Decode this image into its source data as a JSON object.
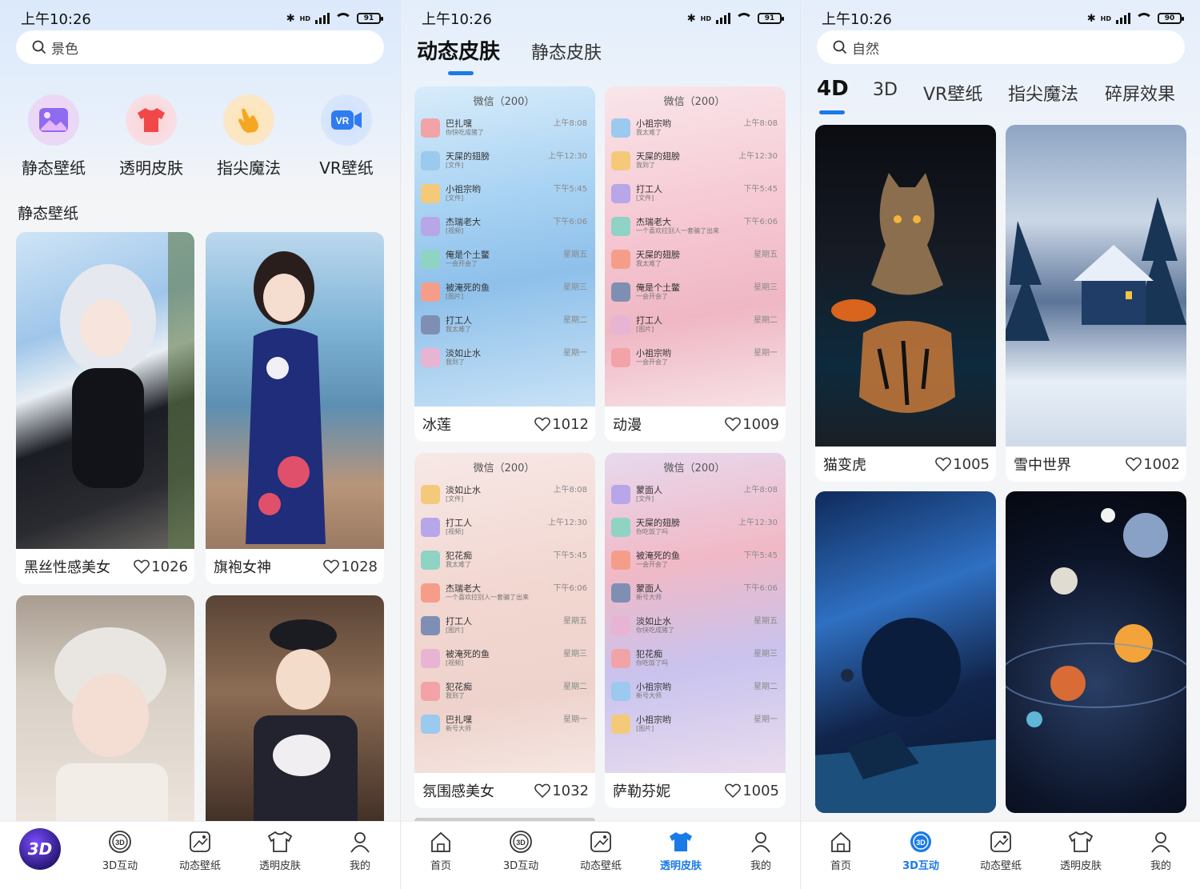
{
  "screen1": {
    "status": {
      "time": "上午10:26",
      "battery": "91",
      "net": "HD"
    },
    "search": {
      "placeholder": "景色"
    },
    "categories": [
      {
        "label": "静态壁纸",
        "icon": "image-icon"
      },
      {
        "label": "透明皮肤",
        "icon": "tshirt-icon"
      },
      {
        "label": "指尖魔法",
        "icon": "pointer-hand-icon"
      },
      {
        "label": "VR壁纸",
        "icon": "vr-camera-icon"
      }
    ],
    "section_title": "静态壁纸",
    "cards": [
      {
        "title": "黑丝性感美女",
        "likes": "1026"
      },
      {
        "title": "旗袍女神",
        "likes": "1028"
      },
      {
        "title": "",
        "likes": ""
      },
      {
        "title": "",
        "likes": ""
      }
    ],
    "tabbar": [
      {
        "label": "",
        "icon": "app-logo-3d"
      },
      {
        "label": "3D互动",
        "icon": "3d-icon"
      },
      {
        "label": "动态壁纸",
        "icon": "dynamic-wallpaper-icon"
      },
      {
        "label": "透明皮肤",
        "icon": "tshirt-icon"
      },
      {
        "label": "我的",
        "icon": "user-icon"
      }
    ],
    "logo_text": "3D"
  },
  "screen2": {
    "status": {
      "time": "上午10:26",
      "battery": "91",
      "net": "HD"
    },
    "tabs": [
      "动态皮肤",
      "静态皮肤"
    ],
    "cards": [
      {
        "title": "冰莲",
        "likes": "1012",
        "chat_title": "微信（200）",
        "rows": [
          {
            "name": "巴扎嘿",
            "msg": "你快吃成猪了",
            "time": "上午8:08"
          },
          {
            "name": "天屎的翅膀",
            "msg": "[文件]",
            "time": "上午12:30"
          },
          {
            "name": "小祖宗哟",
            "msg": "[文件]",
            "time": "下午5:45"
          },
          {
            "name": "杰瑞老大",
            "msg": "[视频]",
            "time": "下午6:06"
          },
          {
            "name": "俺是个土鳖",
            "msg": "一会开会了",
            "time": "星期五"
          },
          {
            "name": "被淹死的鱼",
            "msg": "[图片]",
            "time": "星期三"
          },
          {
            "name": "打工人",
            "msg": "我太难了",
            "time": "星期二"
          },
          {
            "name": "淡如止水",
            "msg": "我到了",
            "time": "星期一"
          }
        ]
      },
      {
        "title": "动漫",
        "likes": "1009",
        "chat_title": "微信（200）",
        "rows": [
          {
            "name": "小祖宗哟",
            "msg": "我太难了",
            "time": "上午8:08"
          },
          {
            "name": "天屎的翅膀",
            "msg": "我到了",
            "time": "上午12:30"
          },
          {
            "name": "打工人",
            "msg": "[文件]",
            "time": "下午5:45"
          },
          {
            "name": "杰瑞老大",
            "msg": "一个喜欢拉别人一套骗了出来",
            "time": "下午6:06"
          },
          {
            "name": "天屎的翅膀",
            "msg": "我太难了",
            "time": "星期五"
          },
          {
            "name": "俺是个土鳖",
            "msg": "一会开会了",
            "time": "星期三"
          },
          {
            "name": "打工人",
            "msg": "[图片]",
            "time": "星期二"
          },
          {
            "name": "小祖宗哟",
            "msg": "一会开会了",
            "time": "星期一"
          }
        ]
      },
      {
        "title": "氛围感美女",
        "likes": "1032",
        "chat_title": "微信（200）",
        "rows": [
          {
            "name": "淡如止水",
            "msg": "[文件]",
            "time": "上午8:08"
          },
          {
            "name": "打工人",
            "msg": "[视频]",
            "time": "上午12:30"
          },
          {
            "name": "犯花痴",
            "msg": "我太难了",
            "time": "下午5:45"
          },
          {
            "name": "杰瑞老大",
            "msg": "一个喜欢拉别人一套骗了出来",
            "time": "下午6:06"
          },
          {
            "name": "打工人",
            "msg": "[图片]",
            "time": "星期五"
          },
          {
            "name": "被淹死的鱼",
            "msg": "[视频]",
            "time": "星期三"
          },
          {
            "name": "犯花痴",
            "msg": "我到了",
            "time": "星期二"
          },
          {
            "name": "巴扎嘿",
            "msg": "新号大师",
            "time": "星期一"
          }
        ]
      },
      {
        "title": "萨勒芬妮",
        "likes": "1005",
        "chat_title": "微信（200）",
        "rows": [
          {
            "name": "蒙面人",
            "msg": "[文件]",
            "time": "上午8:08"
          },
          {
            "name": "天屎的翅膀",
            "msg": "你吃饭了吗",
            "time": "上午12:30"
          },
          {
            "name": "被淹死的鱼",
            "msg": "一会开会了",
            "time": "下午5:45"
          },
          {
            "name": "蒙面人",
            "msg": "新号大师",
            "time": "下午6:06"
          },
          {
            "name": "淡如止水",
            "msg": "你快吃成猪了",
            "time": "星期五"
          },
          {
            "name": "犯花痴",
            "msg": "你吃饭了吗",
            "time": "星期三"
          },
          {
            "name": "小祖宗哟",
            "msg": "新号大师",
            "time": "星期二"
          },
          {
            "name": "小祖宗哟",
            "msg": "[图片]",
            "time": "星期一"
          }
        ]
      }
    ],
    "tabbar": [
      {
        "label": "首页",
        "icon": "home-icon"
      },
      {
        "label": "3D互动",
        "icon": "3d-icon"
      },
      {
        "label": "动态壁纸",
        "icon": "dynamic-wallpaper-icon"
      },
      {
        "label": "透明皮肤",
        "icon": "tshirt-icon"
      },
      {
        "label": "我的",
        "icon": "user-icon"
      }
    ]
  },
  "screen3": {
    "status": {
      "time": "上午10:26",
      "battery": "90",
      "net": "HD"
    },
    "search": {
      "placeholder": "自然"
    },
    "tabs": [
      "4D",
      "3D",
      "VR壁纸",
      "指尖魔法",
      "碎屏效果"
    ],
    "cards": [
      {
        "title": "猫变虎",
        "likes": "1005"
      },
      {
        "title": "雪中世界",
        "likes": "1002"
      },
      {
        "title": "",
        "likes": ""
      },
      {
        "title": "",
        "likes": ""
      }
    ],
    "tabbar": [
      {
        "label": "首页",
        "icon": "home-icon"
      },
      {
        "label": "3D互动",
        "icon": "3d-icon"
      },
      {
        "label": "动态壁纸",
        "icon": "dynamic-wallpaper-icon"
      },
      {
        "label": "透明皮肤",
        "icon": "tshirt-icon"
      },
      {
        "label": "我的",
        "icon": "user-icon"
      }
    ]
  },
  "colors": {
    "accent": "#1a7ae8",
    "background": "#f4f5f7",
    "card": "#ffffff"
  }
}
